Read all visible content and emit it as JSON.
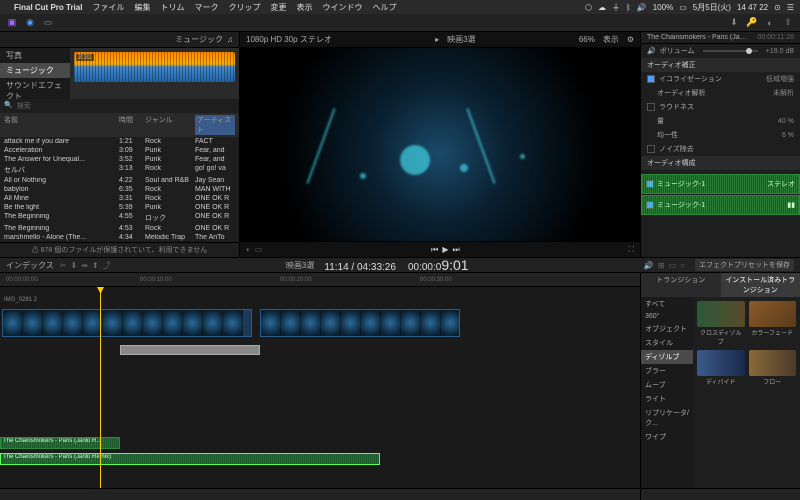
{
  "menubar": {
    "app": "Final Cut Pro Trial",
    "items": [
      "ファイル",
      "編集",
      "トリム",
      "マーク",
      "クリップ",
      "変更",
      "表示",
      "ウインドウ",
      "ヘルプ"
    ],
    "status": {
      "battery": "100%",
      "date": "5月5日(火)",
      "time": "14 47 22"
    }
  },
  "browser": {
    "tab": "ミュージック",
    "sidebar": [
      "写真",
      "ミュージック",
      "サウンドエフェクト"
    ],
    "waveform_time": "3:31",
    "search_placeholder": "検索",
    "columns": {
      "name": "名前",
      "time": "時間",
      "genre": "ジャンル",
      "artist": "アーティスト"
    },
    "tracks": [
      {
        "name": "attack me if you dare",
        "time": "1:21",
        "genre": "Rock",
        "artist": "FACT"
      },
      {
        "name": "Acceleration",
        "time": "3:09",
        "genre": "Punk",
        "artist": "Fear, and"
      },
      {
        "name": "The Answer for Unequal...",
        "time": "3:52",
        "genre": "Punk",
        "artist": "Fear, and"
      },
      {
        "name": "セルバ",
        "time": "3:13",
        "genre": "Rock",
        "artist": "go! go! va"
      },
      {
        "name": "All or Nothing",
        "time": "4:22",
        "genre": "Soul and R&B",
        "artist": "Jay Sean"
      },
      {
        "name": "babylon",
        "time": "6:35",
        "genre": "Rock",
        "artist": "MAN WITH"
      },
      {
        "name": "All Mine",
        "time": "3:31",
        "genre": "Rock",
        "artist": "ONE OK R"
      },
      {
        "name": "Be the light",
        "time": "5:39",
        "genre": "Punk",
        "artist": "ONE OK R"
      },
      {
        "name": "The Beginning",
        "time": "4:55",
        "genre": "ロック",
        "artist": "ONE OK R"
      },
      {
        "name": "The Beginning",
        "time": "4:53",
        "genre": "Rock",
        "artist": "ONE OK R"
      },
      {
        "name": "marshmello - Alone (The...",
        "time": "4:34",
        "genre": "Melodic Trap",
        "artist": "The AnTo"
      }
    ],
    "footer": "⚠ 878 個のファイルが保護されていて、利用できません"
  },
  "viewer": {
    "format": "1080p HD 30p ステレオ",
    "project": "映画3選",
    "zoom": "66%",
    "display": "表示"
  },
  "inspector": {
    "clip_title": "The Chainsmokers - Paris (Jarilo Remix)",
    "clip_time": "00:00:11:28",
    "volume_label": "ボリューム",
    "volume_value": "+19.0 dB",
    "audio_correct": "オーディオ補正",
    "eq": "イコライゼーション",
    "eq_val": "低域増強",
    "analysis": "オーディオ解析",
    "analysis_val": "未解析",
    "loudness": "ラウドネス",
    "loudness_amount": "量",
    "loudness_amount_val": "40 %",
    "loudness_uni": "均一性",
    "loudness_uni_val": "6 %",
    "noise": "ノイズ除去",
    "audio_config": "オーディオ構成",
    "lane1": "ミュージック-1",
    "lane1_mode": "ステレオ",
    "lane2": "ミュージック-1"
  },
  "midbar": {
    "index": "インデックス",
    "project": "映画3選",
    "timecode": "11:14 / 04:33:26",
    "current": "9:01",
    "preset_btn": "エフェクトプリセットを保存"
  },
  "timeline": {
    "marks": [
      "00:00:00:00",
      "00:00:10:00",
      "00:00:20:00",
      "00:00:30:00"
    ],
    "clip_label": "IMG_0281 2",
    "audio1": "The Chainsmokers - Paris (Jarilo R...",
    "audio2": "The Chainsmokers - Paris (Jarilo Remix)"
  },
  "effects": {
    "tabs": [
      "トランジション",
      "インストール済みトランジション"
    ],
    "categories": [
      "すべて",
      "360°",
      "オブジェクト",
      "スタイル",
      "ディゾルブ",
      "ブラー",
      "ムーブ",
      "ライト",
      "リプリケータ/ク...",
      "ワイプ"
    ],
    "items": [
      "クロスディゾルブ",
      "カラーフェード",
      "ディバイド",
      "フロー"
    ]
  }
}
